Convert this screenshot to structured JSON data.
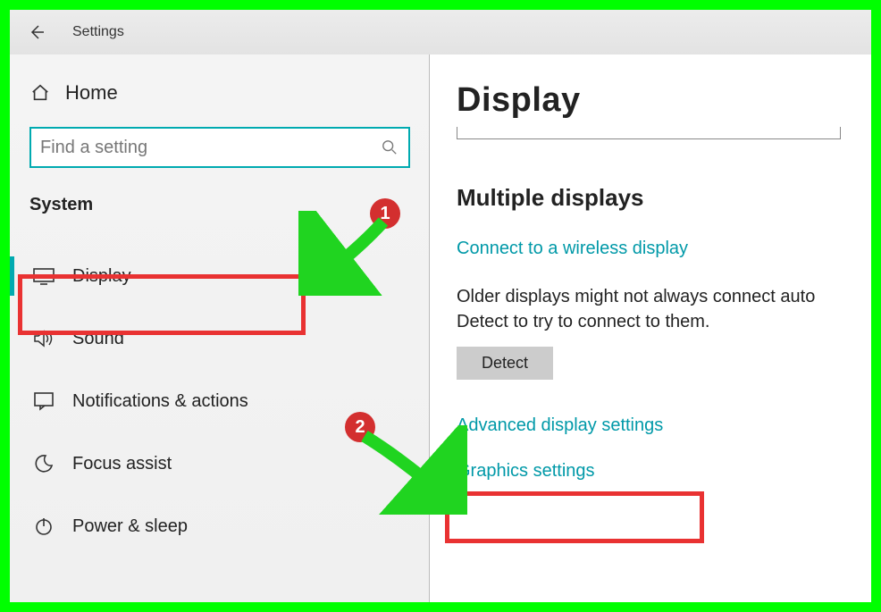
{
  "titlebar": {
    "title": "Settings"
  },
  "sidebar": {
    "home_label": "Home",
    "search_placeholder": "Find a setting",
    "category": "System",
    "items": [
      {
        "label": "Display"
      },
      {
        "label": "Sound"
      },
      {
        "label": "Notifications & actions"
      },
      {
        "label": "Focus assist"
      },
      {
        "label": "Power & sleep"
      }
    ]
  },
  "content": {
    "page_title": "Display",
    "section_title": "Multiple displays",
    "wireless_link": "Connect to a wireless display",
    "desc_line1": "Older displays might not always connect auto",
    "desc_line2": "Detect to try to connect to them.",
    "detect_label": "Detect",
    "advanced_link": "Advanced display settings",
    "graphics_link": "Graphics settings"
  },
  "annotations": {
    "badge1": "1",
    "badge2": "2"
  }
}
